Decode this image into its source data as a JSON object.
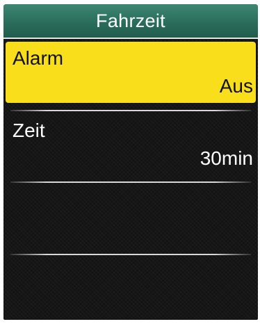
{
  "header": {
    "title": "Fahrzeit"
  },
  "menu": {
    "items": [
      {
        "label": "Alarm",
        "value": "Aus",
        "selected": true
      },
      {
        "label": "Zeit",
        "value": "30min",
        "selected": false
      }
    ]
  },
  "colors": {
    "header_bg": "#2a6d5b",
    "selected_bg": "#f9de1c",
    "screen_bg": "#161616"
  }
}
